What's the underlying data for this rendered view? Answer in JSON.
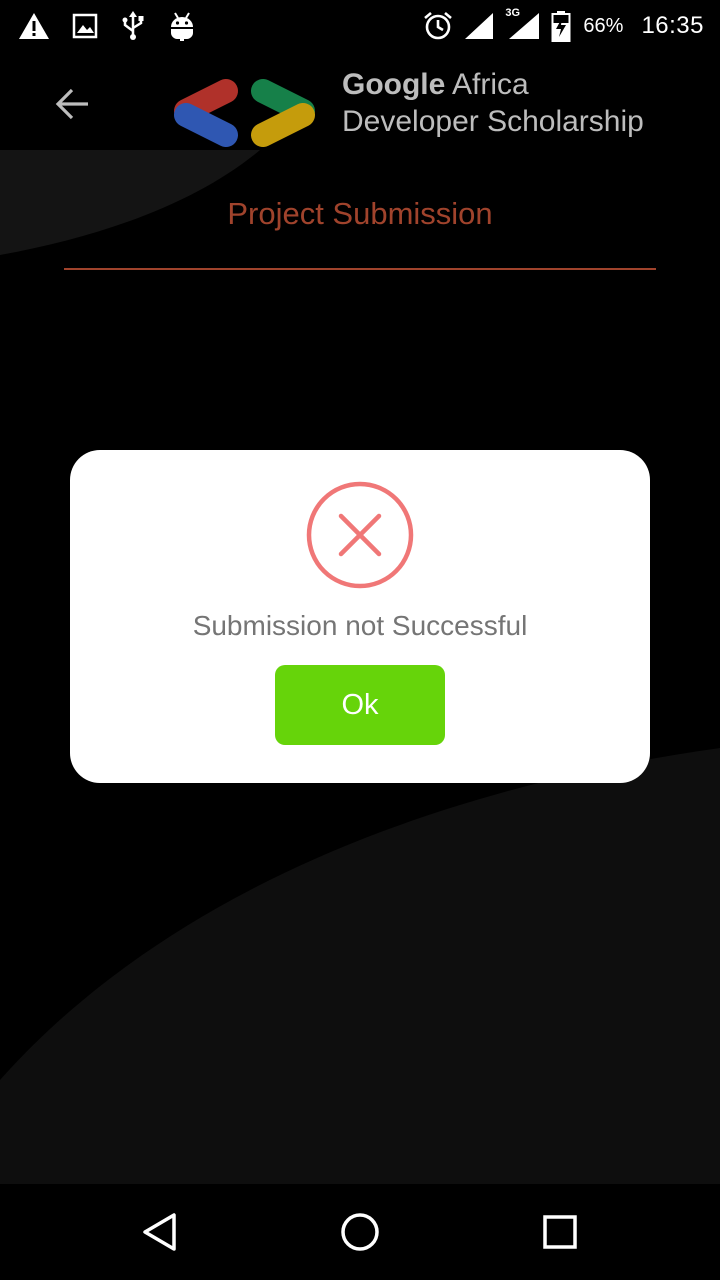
{
  "status_bar": {
    "battery_percent": "66%",
    "time": "16:35",
    "network_type": "3G",
    "icons": [
      "warning-icon",
      "image-icon",
      "usb-icon",
      "android-debug-icon",
      "alarm-icon",
      "wifi-signal-icon",
      "cellular-signal-icon",
      "battery-charging-icon"
    ]
  },
  "app_bar": {
    "back_icon": "arrow-left-icon",
    "brand": {
      "line1_strong": "Google",
      "line1_rest": " Africa",
      "line2": "Developer Scholarship"
    }
  },
  "page": {
    "title": "Project Submission"
  },
  "dialog": {
    "icon": "error-x-icon",
    "message": "Submission not Successful",
    "ok_label": "Ok"
  },
  "nav_bar": {
    "items": [
      "back-triangle-icon",
      "home-circle-icon",
      "recents-square-icon"
    ]
  },
  "colors": {
    "background": "#000000",
    "accent_title": "#a0432c",
    "error_red": "#f07777",
    "ok_green": "#66d40a",
    "dialog_text": "#757575",
    "brand_text": "#bdbdbd"
  }
}
